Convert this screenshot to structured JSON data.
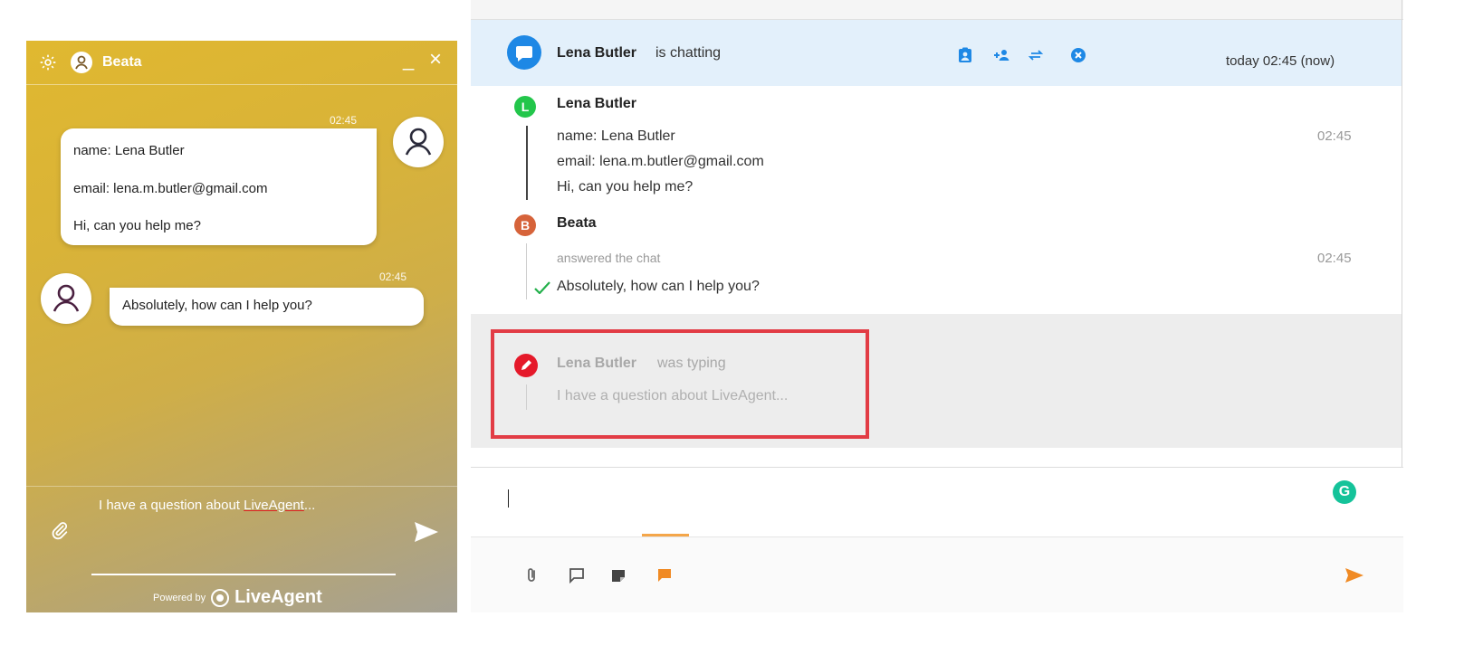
{
  "widget": {
    "agent_name": "Beata",
    "minimize_label": "_",
    "close_label": "×",
    "visitor_message": {
      "time": "02:45",
      "lines": [
        "name: Lena Butler",
        "email: lena.m.butler@gmail.com",
        "Hi, can you help me?"
      ]
    },
    "agent_message": {
      "time": "02:45",
      "text": "Absolutely, how can I help you?"
    },
    "input": {
      "text_before": "I have a question about ",
      "text_underlined": "LiveAgent",
      "text_after": "..."
    },
    "powered_by": "Powered by",
    "brand": "LiveAgent",
    "accent_color": "#e0b830"
  },
  "panel": {
    "header": {
      "name": "Lena Butler",
      "status": "is chatting",
      "time": "today 02:45 (now)",
      "icons": [
        "assign-icon",
        "add-user-icon",
        "transfer-icon",
        "end-chat-icon"
      ]
    },
    "messages": [
      {
        "avatar_letter": "L",
        "avatar_color": "#23c64b",
        "sender": "Lena Butler",
        "time": "02:45",
        "lines": [
          "name: Lena Butler",
          "email: lena.m.butler@gmail.com",
          "Hi, can you help me?"
        ]
      },
      {
        "avatar_letter": "B",
        "avatar_color": "#d6633a",
        "sender": "Beata",
        "sub": "answered the chat",
        "time": "02:45",
        "lines": [
          "Absolutely, how can I help you?"
        ]
      }
    ],
    "typing": {
      "name": "Lena Butler",
      "status": "was typing",
      "text": "I have a question about LiveAgent..."
    },
    "grammarly_letter": "G",
    "toolbar_icons": [
      "attachment-icon",
      "chat-icon",
      "note-icon",
      "message-icon"
    ],
    "highlight_color": "#e23c45"
  }
}
